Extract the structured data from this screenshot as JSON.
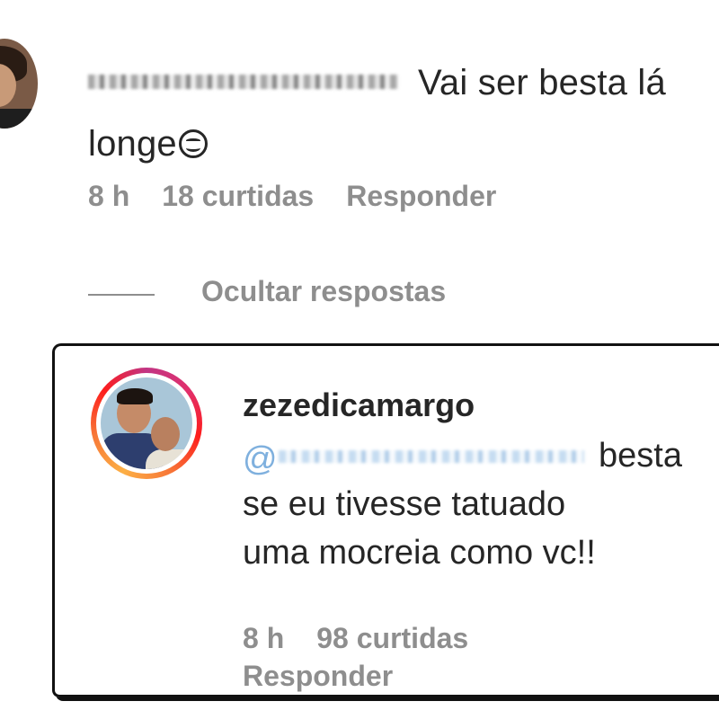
{
  "comment": {
    "username": "luciana_de_paula",
    "text": "Vai ser besta lá",
    "text_line2": "longe",
    "emoji": "grinning-face-emoji",
    "time": "8 h",
    "likes": "18 curtidas",
    "reply_label": "Responder"
  },
  "hide_replies_label": "Ocultar respostas",
  "reply": {
    "username": "zezedicamargo",
    "mention": "@luciana_de_paula",
    "text_line1": "besta",
    "text_line2": "se eu tivesse tatuado",
    "text_line3": "uma mocreia como vc!!",
    "time": "8 h",
    "likes": "98 curtidas",
    "reply_label": "Responder"
  },
  "colors": {
    "text": "#262626",
    "secondary": "#8e8e8e",
    "mention": "#a7c8e8",
    "story_ring_start": "#c13584",
    "story_ring_end": "#fcaf45"
  }
}
